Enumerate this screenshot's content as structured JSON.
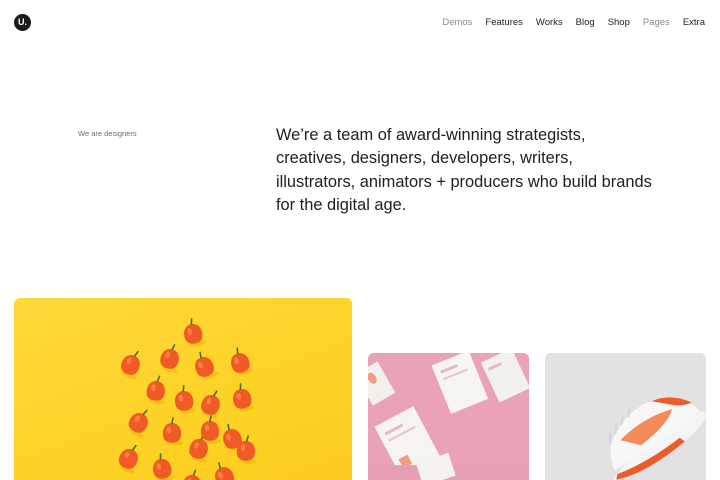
{
  "header": {
    "logo_text": "U.",
    "nav": [
      {
        "label": "Demos",
        "muted": true
      },
      {
        "label": "Features",
        "muted": false
      },
      {
        "label": "Works",
        "muted": false
      },
      {
        "label": "Blog",
        "muted": false
      },
      {
        "label": "Shop",
        "muted": false
      },
      {
        "label": "Pages",
        "muted": true
      },
      {
        "label": "Extra",
        "muted": false
      }
    ]
  },
  "intro": {
    "eyebrow": "We are designers",
    "headline": "We’re a team of award-winning strategists, creatives, designers, developers, writers, illustrators, animators + producers who build brands for the digital age."
  },
  "portfolio": {
    "items": [
      {
        "image": "peppers-on-yellow",
        "bg_color": "#fdd227"
      },
      {
        "image": "print-cards-on-pink",
        "bg_color": "#e9a2b4"
      },
      {
        "image": "sneaker-on-grey",
        "bg_color": "#e4e4e4"
      }
    ]
  },
  "colors": {
    "text": "#1a1a1a",
    "muted": "#8a8a8a",
    "pepper": "#f05a24"
  }
}
